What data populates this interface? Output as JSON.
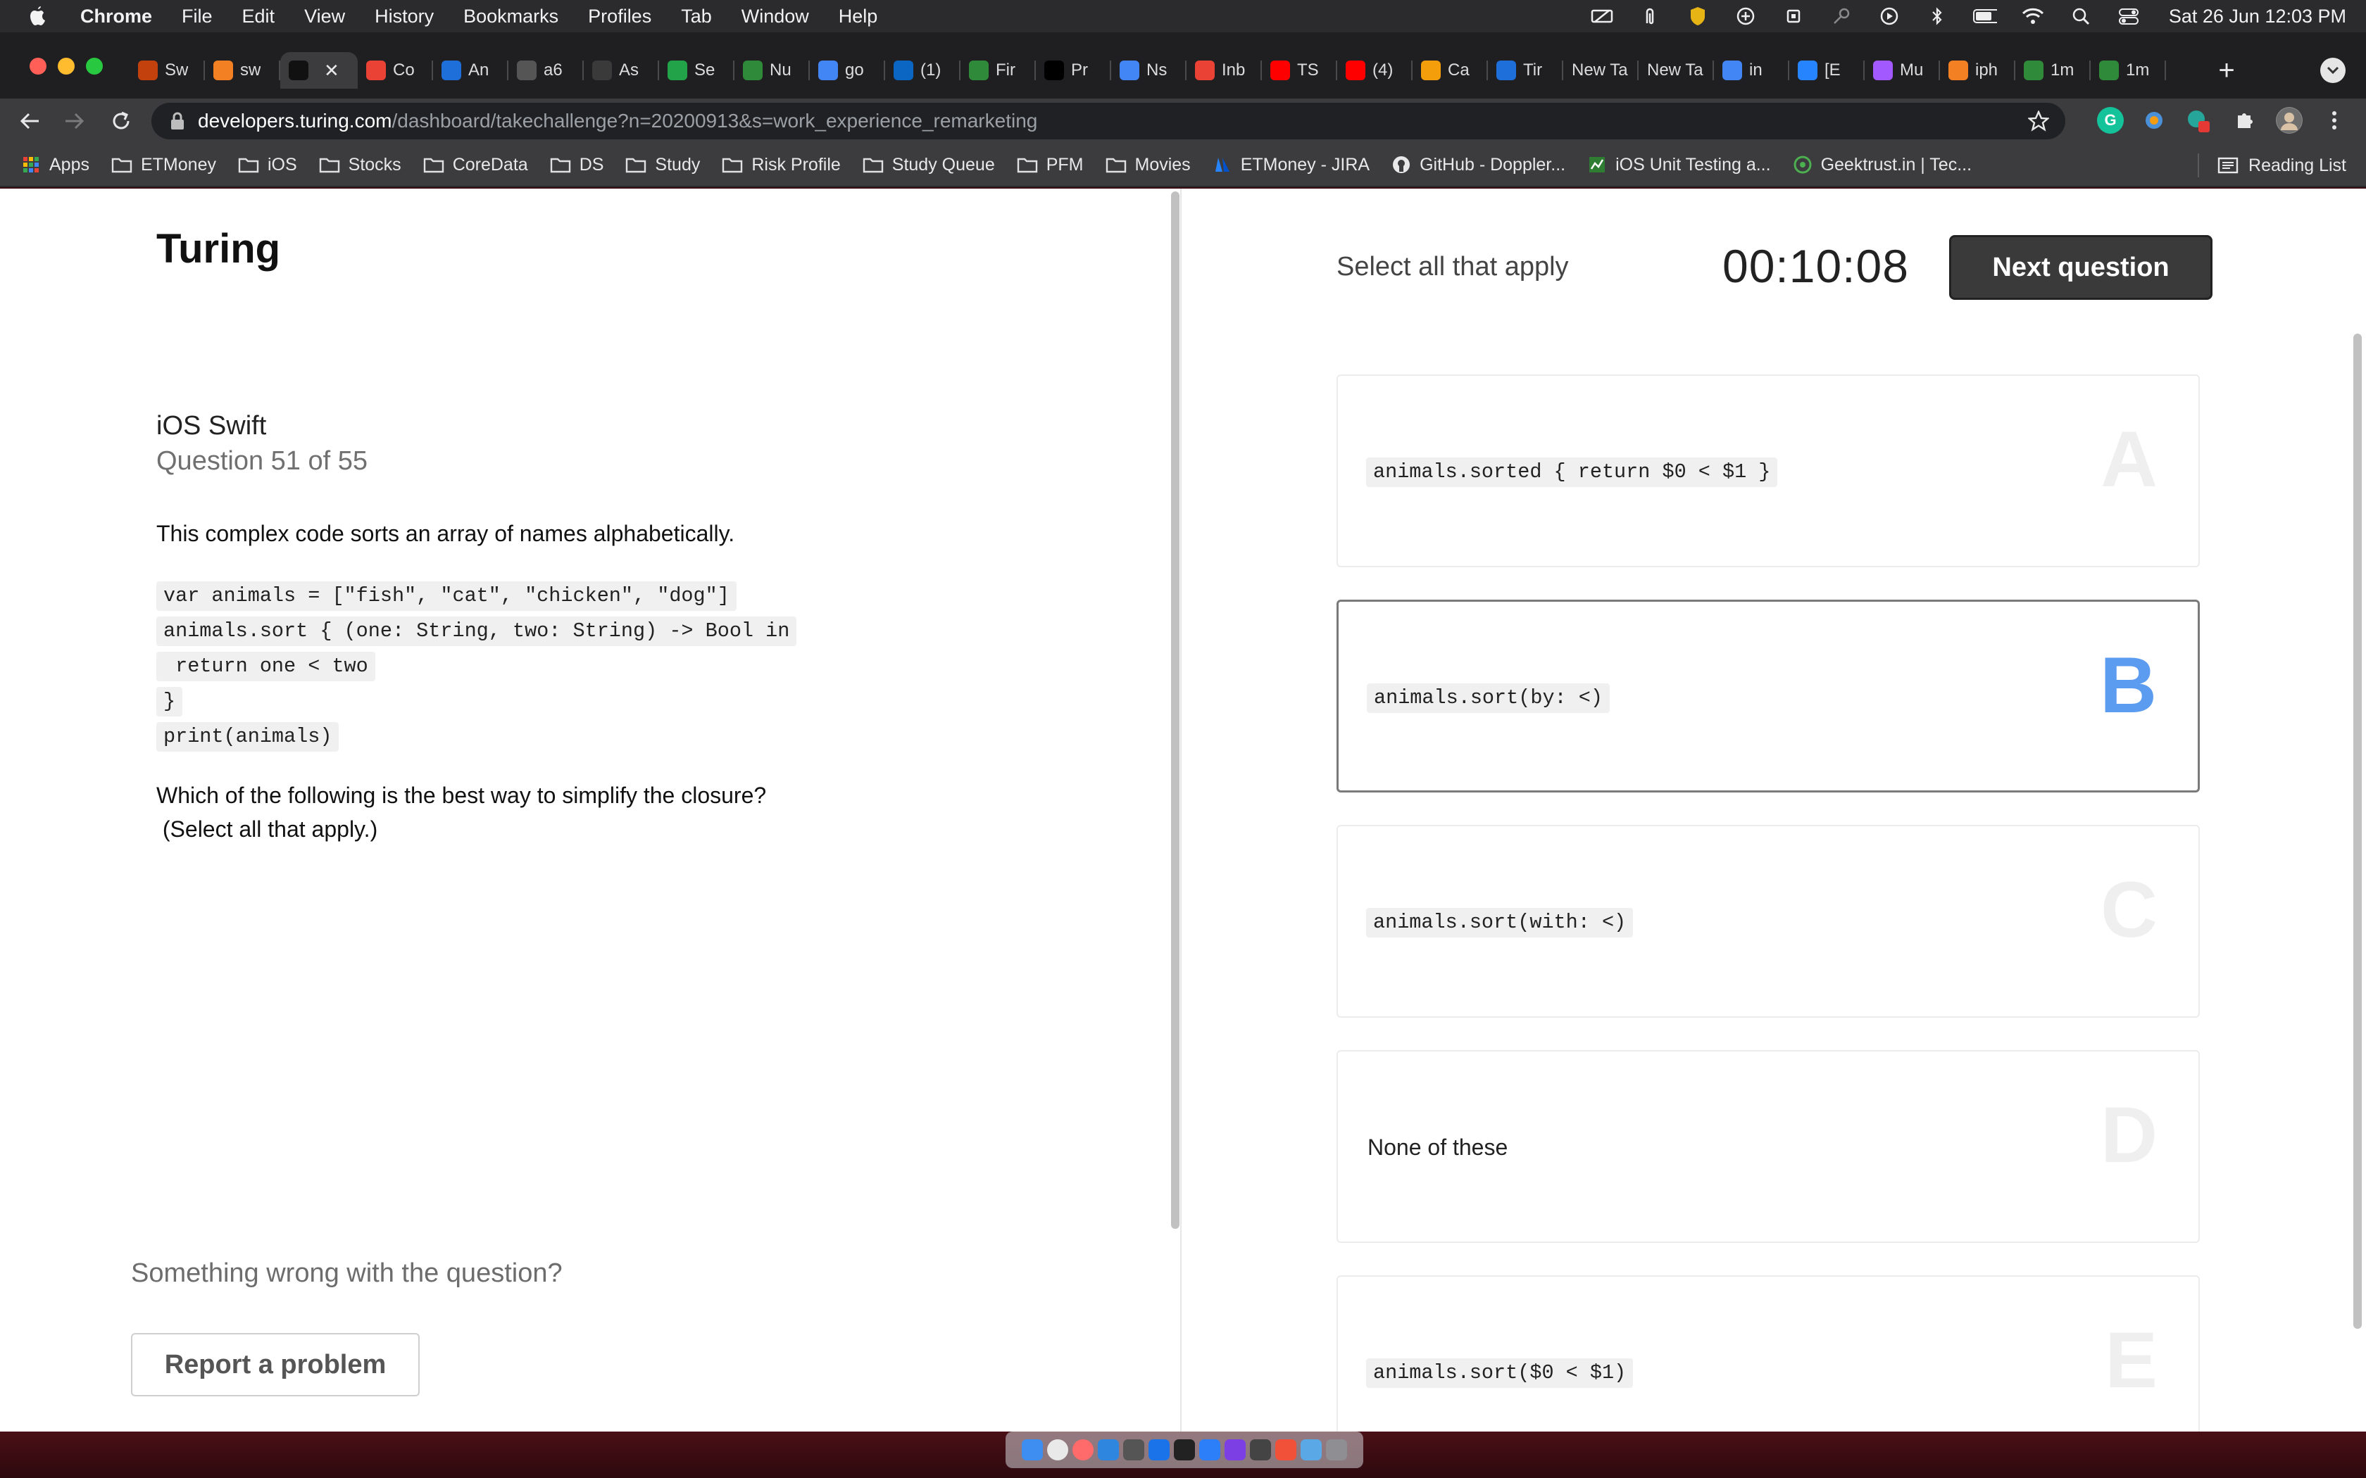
{
  "menubar": {
    "app_name": "Chrome",
    "items": [
      "File",
      "Edit",
      "View",
      "History",
      "Bookmarks",
      "Profiles",
      "Tab",
      "Window",
      "Help"
    ],
    "clock": "Sat 26 Jun  12:03 PM"
  },
  "tabs": [
    {
      "title": "Sw",
      "icon": "stackoverflow-icon",
      "color": "#c2410c"
    },
    {
      "title": "sw",
      "icon": "stackoverflow-icon",
      "color": "#f48024"
    },
    {
      "title": "",
      "icon": "turing-icon",
      "color": "#111111",
      "active": true
    },
    {
      "title": "Co",
      "icon": "gmail-icon",
      "color": "#ea4335"
    },
    {
      "title": "An",
      "icon": "dev-d-icon",
      "color": "#1e6fd9"
    },
    {
      "title": "a6",
      "icon": "globe-icon",
      "color": "#555555"
    },
    {
      "title": "As",
      "icon": "grid-icon",
      "color": "#3a3a3a"
    },
    {
      "title": "Se",
      "icon": "phone-icon",
      "color": "#22a34a"
    },
    {
      "title": "Nu",
      "icon": "leaf-icon",
      "color": "#2f8a3a"
    },
    {
      "title": "go",
      "icon": "google-icon",
      "color": "#4285f4"
    },
    {
      "title": "(1)",
      "icon": "linkedin-icon",
      "color": "#0a66c2"
    },
    {
      "title": "Fir",
      "icon": "leaf-icon",
      "color": "#2f8a3a"
    },
    {
      "title": "Pr",
      "icon": "medium-icon",
      "color": "#000000"
    },
    {
      "title": "Ns",
      "icon": "google-icon",
      "color": "#4285f4"
    },
    {
      "title": "Inb",
      "icon": "gmail-icon",
      "color": "#ea4335"
    },
    {
      "title": "TS",
      "icon": "youtube-icon",
      "color": "#ff0000"
    },
    {
      "title": "(4)",
      "icon": "youtube-icon",
      "color": "#ff0000"
    },
    {
      "title": "Ca",
      "icon": "dots-icon",
      "color": "#f59e0b"
    },
    {
      "title": "Tir",
      "icon": "dev-d-icon",
      "color": "#1e6fd9"
    },
    {
      "title": "New Ta",
      "icon": "",
      "color": ""
    },
    {
      "title": "New Ta",
      "icon": "",
      "color": ""
    },
    {
      "title": "in",
      "icon": "google-icon",
      "color": "#4285f4"
    },
    {
      "title": "[E",
      "icon": "jira-icon",
      "color": "#2684ff"
    },
    {
      "title": "Mu",
      "icon": "figma-icon",
      "color": "#a259ff"
    },
    {
      "title": "iph",
      "icon": "stackoverflow-icon",
      "color": "#f48024"
    },
    {
      "title": "1m",
      "icon": "leaf-icon",
      "color": "#2f8a3a"
    },
    {
      "title": "1m",
      "icon": "leaf-icon",
      "color": "#2f8a3a"
    }
  ],
  "omnibox": {
    "host": "developers.turing.com",
    "path": "/dashboard/takechallenge?n=20200913&s=work_experience_remarketing"
  },
  "bookmarks": [
    {
      "label": "Apps",
      "type": "apps"
    },
    {
      "label": "ETMoney",
      "type": "folder"
    },
    {
      "label": "iOS",
      "type": "folder"
    },
    {
      "label": "Stocks",
      "type": "folder"
    },
    {
      "label": "CoreData",
      "type": "folder"
    },
    {
      "label": "DS",
      "type": "folder"
    },
    {
      "label": "Study",
      "type": "folder"
    },
    {
      "label": "Risk Profile",
      "type": "folder"
    },
    {
      "label": "Study Queue",
      "type": "folder"
    },
    {
      "label": "PFM",
      "type": "folder"
    },
    {
      "label": "Movies",
      "type": "folder"
    },
    {
      "label": "ETMoney - JIRA",
      "type": "atlassian"
    },
    {
      "label": "GitHub - Doppler...",
      "type": "github"
    },
    {
      "label": "iOS Unit Testing a...",
      "type": "chart"
    },
    {
      "label": "Geektrust.in | Tec...",
      "type": "geektrust"
    }
  ],
  "reading_list": "Reading List",
  "page": {
    "brand": "Turing",
    "course": "iOS Swift",
    "question_number": "Question 51 of 55",
    "prompt": "This complex code sorts an array of names alphabetically.",
    "code_lines": [
      "var animals = [\"fish\", \"cat\", \"chicken\", \"dog\"]",
      "animals.sort { (one: String, two: String) -> Bool in",
      " return one < two",
      "}",
      "print(animals)"
    ],
    "question": "Which of the following is the best way to simplify the closure?\n (Select all that apply.)",
    "wrong_text": "Something wrong with the question?",
    "report_label": "Report a problem",
    "instruction": "Select all that apply",
    "timer": "00:10:08",
    "next_label": "Next question",
    "options": [
      {
        "letter": "A",
        "code": "animals.sorted { return $0 < $1 }",
        "is_code": true,
        "selected": false
      },
      {
        "letter": "B",
        "code": "animals.sort(by: <)",
        "is_code": true,
        "selected": true
      },
      {
        "letter": "C",
        "code": "animals.sort(with: <)",
        "is_code": true,
        "selected": false
      },
      {
        "letter": "D",
        "code": "None of these",
        "is_code": false,
        "selected": false
      },
      {
        "letter": "E",
        "code": "animals.sort($0 < $1)",
        "is_code": true,
        "selected": false
      }
    ]
  },
  "colors": {
    "selected_letter": "#5b9bf0",
    "next_button": "#3a3a3a"
  }
}
